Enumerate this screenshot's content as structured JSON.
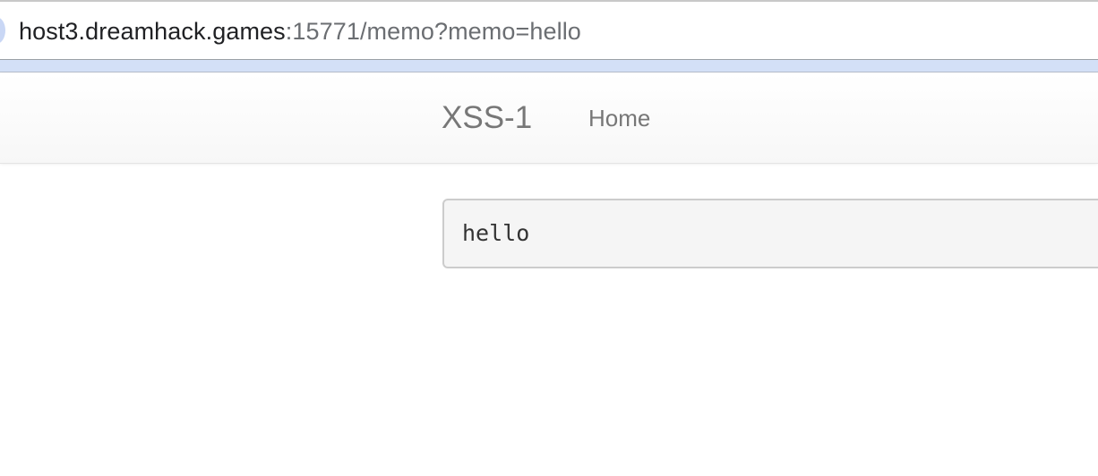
{
  "browser": {
    "url_host": "host3.dreamhack.games",
    "url_rest": ":15771/memo?memo=hello"
  },
  "navbar": {
    "brand": "XSS-1",
    "links": [
      {
        "label": "Home"
      }
    ]
  },
  "main": {
    "memo_text": "hello"
  },
  "colors": {
    "strip": "#d3e0f7",
    "nav_text": "#777777",
    "memo_bg": "#f5f5f5",
    "memo_border": "#cccccc"
  }
}
